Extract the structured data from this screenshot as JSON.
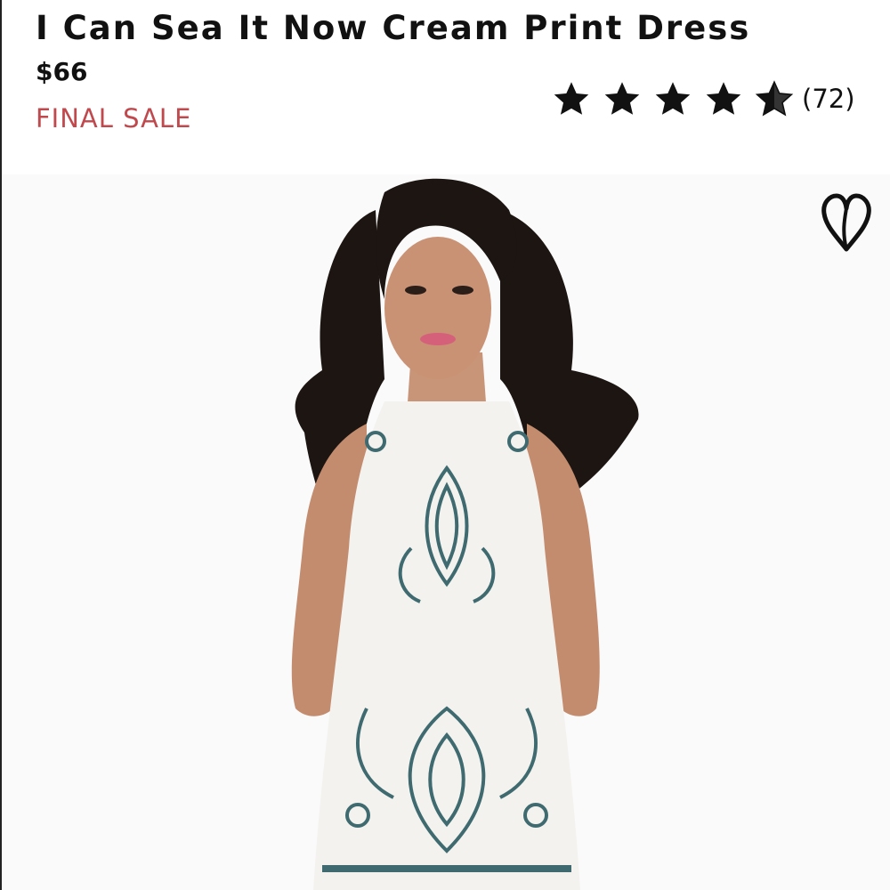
{
  "product": {
    "title": "I Can Sea It Now Cream Print Dress",
    "price": "$66",
    "sale_badge": "FINAL SALE"
  },
  "rating": {
    "stars": 4.5,
    "max_stars": 5,
    "review_count": "(72)"
  },
  "image": {
    "subject": "product-photo",
    "wishlist_icon": "heart-outline-icon"
  },
  "colors": {
    "sale_red": "#c0494e",
    "text": "#111111",
    "dress_print": "#3f6b70"
  }
}
